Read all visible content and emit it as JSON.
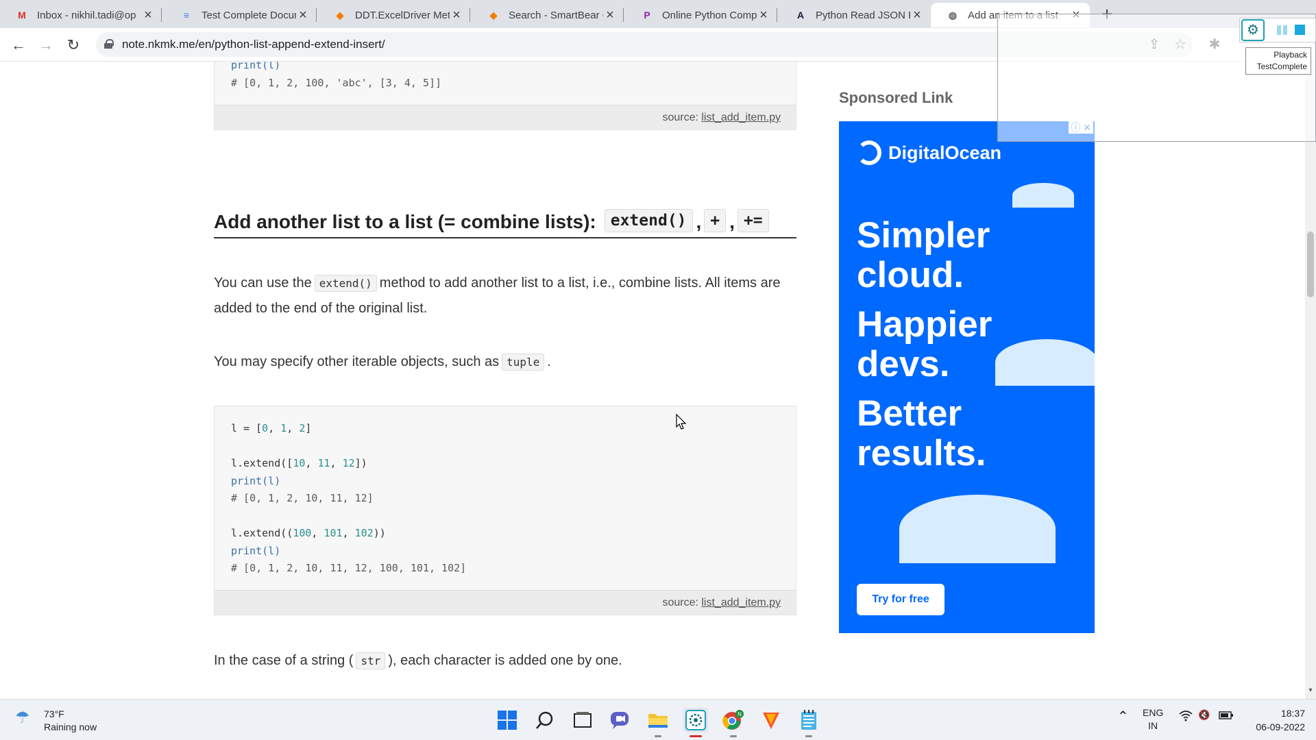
{
  "browser": {
    "tabs": [
      {
        "title": "Inbox - nikhil.tadi@op",
        "favicon": "gmail-icon",
        "fav_color": "#d93025",
        "fav_glyph": "M",
        "active": false
      },
      {
        "title": "Test Complete Docum",
        "favicon": "google-docs-icon",
        "fav_color": "#4285f4",
        "fav_glyph": "≡",
        "active": false
      },
      {
        "title": "DDT.ExcelDriver Meth",
        "favicon": "smartbear-icon",
        "fav_color": "#f57c00",
        "fav_glyph": "◆",
        "active": false
      },
      {
        "title": "Search - SmartBear Co",
        "favicon": "smartbear-icon",
        "fav_color": "#f57c00",
        "fav_glyph": "◆",
        "active": false
      },
      {
        "title": "Online Python Compil",
        "favicon": "programiz-icon",
        "fav_color": "#8e24aa",
        "fav_glyph": "P",
        "active": false
      },
      {
        "title": "Python Read JSON Fil",
        "favicon": "geeks-icon",
        "fav_color": "#1a1a40",
        "fav_glyph": "A",
        "active": false
      },
      {
        "title": "Add an item to a list",
        "favicon": "globe-icon",
        "fav_color": "#5f6368",
        "fav_glyph": "◍",
        "active": true
      }
    ],
    "new_tab_glyph": "+",
    "url": "note.nkmk.me/en/python-list-append-extend-insert/"
  },
  "content": {
    "top_code": {
      "lines": [
        "print(l)",
        "# [0, 1, 2, 100, 'abc', [3, 4, 5]]"
      ],
      "source_label": "source:",
      "source_file": "list_add_item.py"
    },
    "heading": {
      "text": "Add another list to a list (= combine lists):",
      "code1": "extend()",
      "comma1": ",",
      "code2": "+",
      "comma2": ",",
      "code3": "+="
    },
    "para1": {
      "before": "You can use the",
      "code": "extend()",
      "after": "method to add another list to a list, i.e., combine lists. All items are added to the end of the original list."
    },
    "para2": {
      "before": "You may specify other iterable objects, such as",
      "code": "tuple",
      "after": "."
    },
    "main_code": {
      "lines": [
        "l = [0, 1, 2]",
        "",
        "l.extend([10, 11, 12])",
        "print(l)",
        "# [0, 1, 2, 10, 11, 12]",
        "",
        "l.extend((100, 101, 102))",
        "print(l)",
        "# [0, 1, 2, 10, 11, 12, 100, 101, 102]"
      ],
      "source_label": "source:",
      "source_file": "list_add_item.py"
    },
    "para3": {
      "before": "In the case of a string (",
      "code": "str",
      "after": "), each character is added one by one."
    }
  },
  "sidebar": {
    "sponsored_label": "Sponsored Link",
    "ad": {
      "brand": "DigitalOcean",
      "line1": "Simpler",
      "line2": "cloud.",
      "line3": "Happier",
      "line4": "devs.",
      "line5": "Better",
      "line6": "results.",
      "cta": "Try for free",
      "bg_color": "#0069ff"
    }
  },
  "testcomplete": {
    "tooltip_line1": "Playback",
    "tooltip_line2": "TestComplete"
  },
  "taskbar": {
    "weather_temp": "73°F",
    "weather_desc": "Raining now",
    "apps": [
      "windows-start-icon",
      "search-icon",
      "task-view-icon",
      "teams-chat-icon",
      "file-explorer-icon",
      "testcomplete-icon",
      "chrome-icon",
      "brave-icon",
      "notepad-icon"
    ],
    "lang_line1": "ENG",
    "lang_line2": "IN",
    "time": "18:37",
    "date": "06-09-2022"
  }
}
